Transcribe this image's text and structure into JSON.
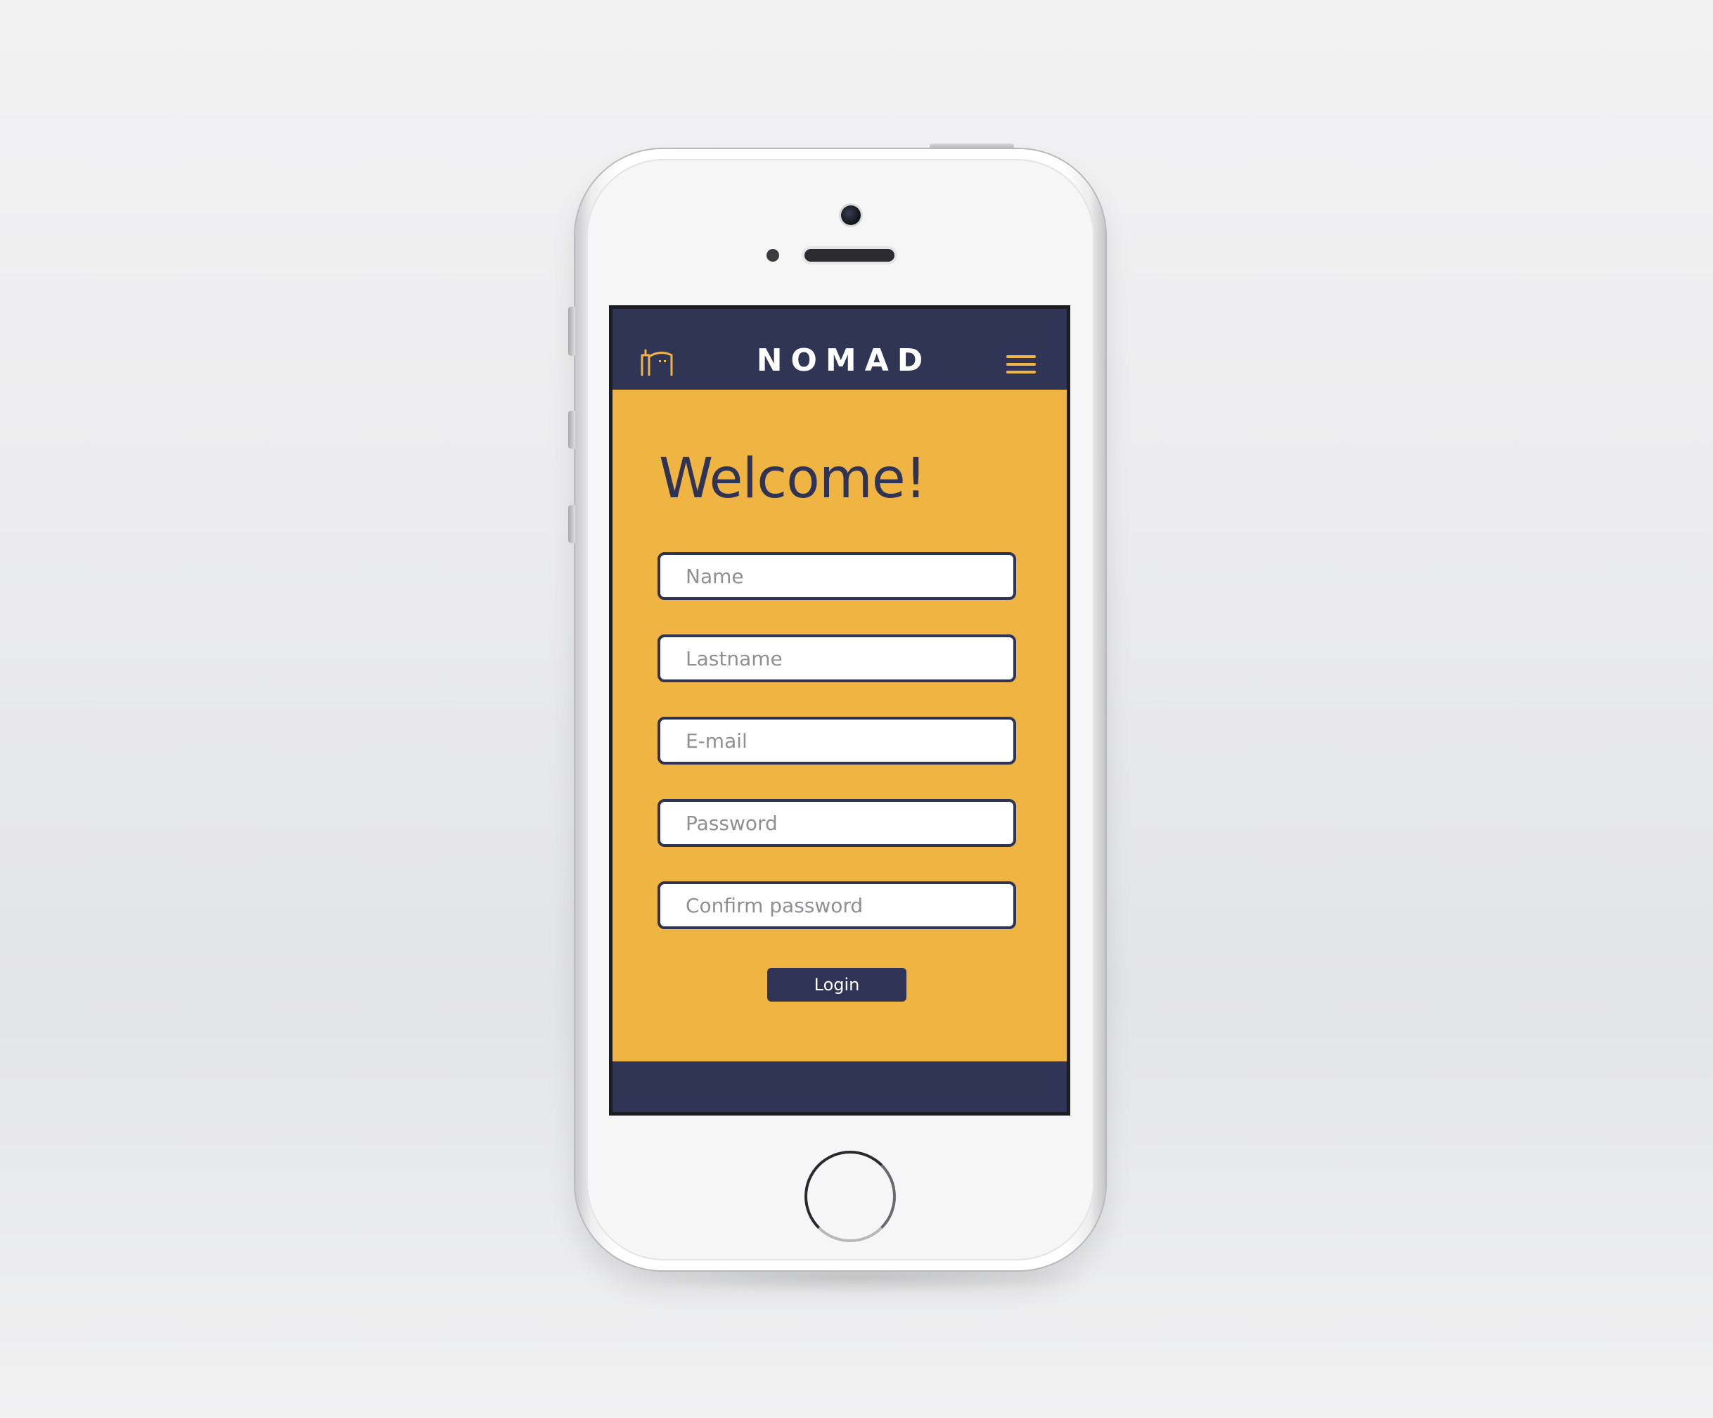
{
  "app": {
    "brand": "NOMAD",
    "logo_icon": "building-outline-icon",
    "menu_icon": "hamburger-menu-icon"
  },
  "signup": {
    "heading": "Welcome!",
    "fields": [
      {
        "placeholder": "Name",
        "type": "text"
      },
      {
        "placeholder": "Lastname",
        "type": "text"
      },
      {
        "placeholder": "E-mail",
        "type": "email"
      },
      {
        "placeholder": "Password",
        "type": "password"
      },
      {
        "placeholder": "Confirm password",
        "type": "password"
      }
    ],
    "submit_label": "Login"
  },
  "colors": {
    "header": "#303455",
    "accent": "#f0b443",
    "text_dark": "#2f3355",
    "field_bg": "#ffffff"
  }
}
